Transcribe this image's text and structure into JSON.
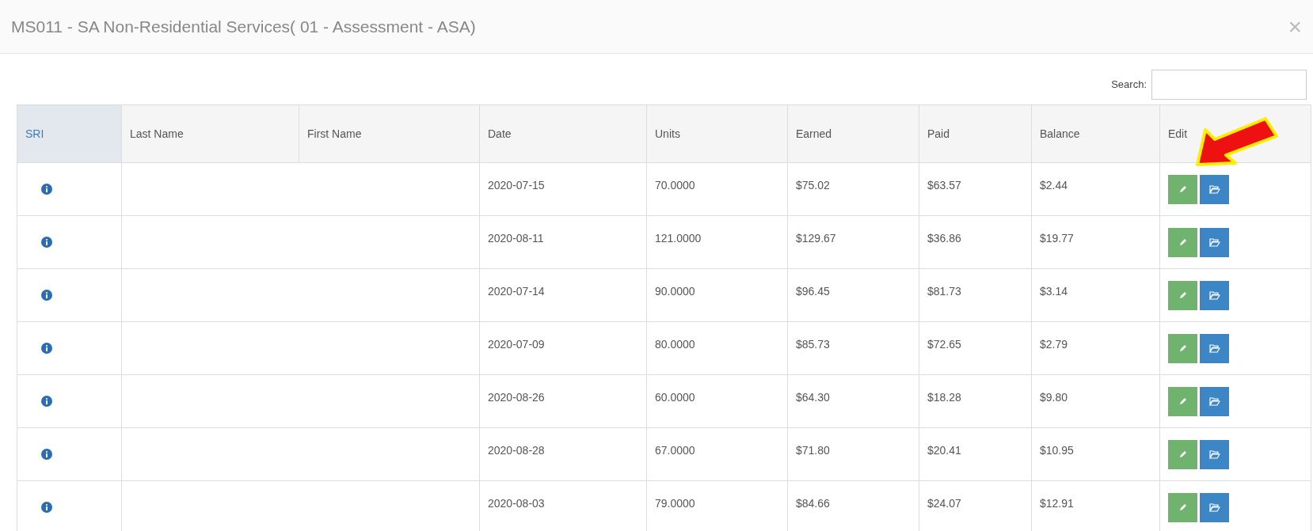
{
  "dialog": {
    "title": "MS011 - SA Non-Residential Services( 01 - Assessment - ASA)",
    "close": "×"
  },
  "search": {
    "label": "Search:"
  },
  "table": {
    "columns": [
      {
        "label": "SRI",
        "sorted": true
      },
      {
        "label": "Last Name",
        "sorted": false
      },
      {
        "label": "First Name",
        "sorted": false
      },
      {
        "label": "Date",
        "sorted": false
      },
      {
        "label": "Units",
        "sorted": false
      },
      {
        "label": "Earned",
        "sorted": false
      },
      {
        "label": "Paid",
        "sorted": false
      },
      {
        "label": "Balance",
        "sorted": false
      },
      {
        "label": "Edit",
        "sorted": false
      }
    ],
    "rows": [
      {
        "date": "2020-07-15",
        "units": "70.0000",
        "earned": "$75.02",
        "paid": "$63.57",
        "balance": "$2.44"
      },
      {
        "date": "2020-08-11",
        "units": "121.0000",
        "earned": "$129.67",
        "paid": "$36.86",
        "balance": "$19.77"
      },
      {
        "date": "2020-07-14",
        "units": "90.0000",
        "earned": "$96.45",
        "paid": "$81.73",
        "balance": "$3.14"
      },
      {
        "date": "2020-07-09",
        "units": "80.0000",
        "earned": "$85.73",
        "paid": "$72.65",
        "balance": "$2.79"
      },
      {
        "date": "2020-08-26",
        "units": "60.0000",
        "earned": "$64.30",
        "paid": "$18.28",
        "balance": "$9.80"
      },
      {
        "date": "2020-08-28",
        "units": "67.0000",
        "earned": "$71.80",
        "paid": "$20.41",
        "balance": "$10.95"
      },
      {
        "date": "2020-08-03",
        "units": "79.0000",
        "earned": "$84.66",
        "paid": "$24.07",
        "balance": "$12.91"
      }
    ]
  }
}
